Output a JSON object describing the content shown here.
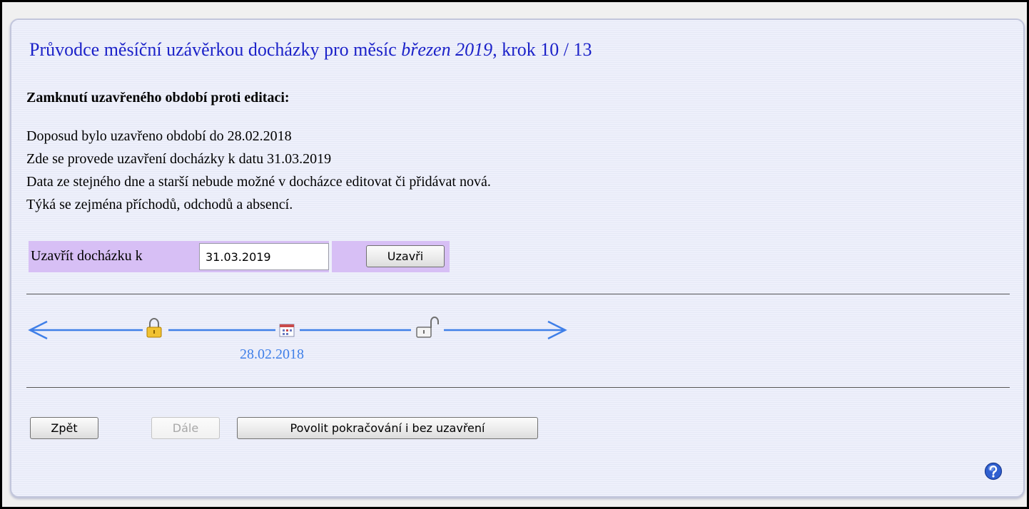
{
  "wizard": {
    "title_prefix": "Průvodce měsíční uzávěrkou docházky pro měsíc ",
    "month": "březen 2019",
    "title_suffix": ", krok 10 / 13"
  },
  "section_heading": "Zamknutí uzavřeného období proti editaci:",
  "info_lines": [
    "Doposud bylo uzavřeno období do 28.02.2018",
    "Zde se provede uzavření docházky k datu 31.03.2019",
    "Data ze stejného dne a starší nebude možné v docházce editovat či přidávat nová.",
    "Týká se zejména příchodů, odchodů a absencí."
  ],
  "close_form": {
    "label": "Uzavřít docházku k",
    "date_value": "31.03.2019",
    "button_label": "Uzavři"
  },
  "timeline": {
    "date_label": "28.02.2018",
    "icons": [
      "arrow-left-icon",
      "lock-closed-icon",
      "calendar-icon",
      "lock-open-icon",
      "arrow-right-icon"
    ],
    "color": "#3f7fe8"
  },
  "nav": {
    "back_label": "Zpět",
    "next_label": "Dále",
    "allow_label": "Povolit pokračování i bez uzavření"
  },
  "help_icon": "help-icon",
  "colors": {
    "title": "#1c22c9",
    "highlight": "#d7bff5",
    "timeline": "#3f7fe8"
  }
}
